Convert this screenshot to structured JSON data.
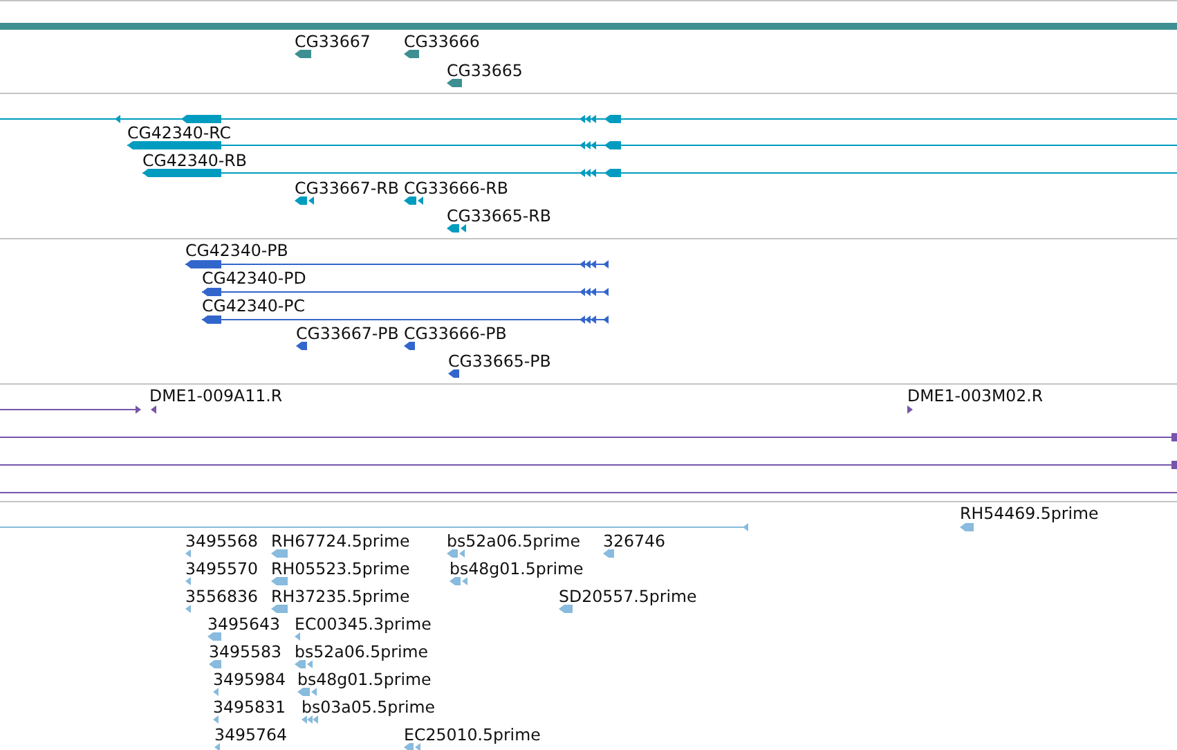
{
  "tracks": [
    {
      "color": "#3d8f91",
      "features": [
        {
          "label": "CG33667"
        },
        {
          "label": "CG33666"
        },
        {
          "label": "CG33665"
        }
      ]
    },
    {
      "color": "#009cbf",
      "features": [
        {
          "label": "CG42340-RC"
        },
        {
          "label": "CG42340-RB"
        },
        {
          "label": "CG33667-RB"
        },
        {
          "label": "CG33666-RB"
        },
        {
          "label": "CG33665-RB"
        }
      ]
    },
    {
      "color": "#3366cc",
      "features": [
        {
          "label": "CG42340-PB"
        },
        {
          "label": "CG42340-PD"
        },
        {
          "label": "CG42340-PC"
        },
        {
          "label": "CG33667-PB"
        },
        {
          "label": "CG33666-PB"
        },
        {
          "label": "CG33665-PB"
        }
      ]
    },
    {
      "color": "#7755aa",
      "features": [
        {
          "label": "DME1-009A11.R"
        },
        {
          "label": "DME1-003M02.R"
        }
      ]
    },
    {
      "color": "#88bbdd",
      "features": [
        {
          "label": "RH54469.5prime"
        },
        {
          "label": "3495568"
        },
        {
          "label": "RH67724.5prime"
        },
        {
          "label": "bs52a06.5prime"
        },
        {
          "label": "326746"
        },
        {
          "label": "3495570"
        },
        {
          "label": "RH05523.5prime"
        },
        {
          "label": "bs48g01.5prime"
        },
        {
          "label": "3556836"
        },
        {
          "label": "RH37235.5prime"
        },
        {
          "label": "SD20557.5prime"
        },
        {
          "label": "3495643"
        },
        {
          "label": "EC00345.3prime"
        },
        {
          "label": "3495583"
        },
        {
          "label": "bs52a06.5prime"
        },
        {
          "label": "3495984"
        },
        {
          "label": "bs48g01.5prime"
        },
        {
          "label": "3495831"
        },
        {
          "label": "bs03a05.5prime"
        },
        {
          "label": "3495764"
        },
        {
          "label": "EC25010.5prime"
        }
      ]
    }
  ]
}
